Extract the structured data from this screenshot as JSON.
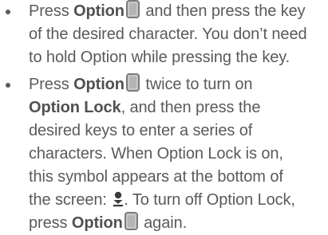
{
  "items": [
    {
      "lines": [
        {
          "before": "Press ",
          "bold": "Option",
          "after": " and then press the key",
          "key_icon": "option-key-icon"
        },
        {
          "text": "of the desired character. You don’t need"
        },
        {
          "text": "to hold Option while pressing the key."
        }
      ]
    },
    {
      "lines": [
        {
          "before": "Press ",
          "bold": "Option",
          "after": " twice to turn on",
          "key_icon": "option-key-icon"
        },
        {
          "bold": "Option Lock",
          "after": ", and then press the"
        },
        {
          "text": "desired keys to enter a series of"
        },
        {
          "text": "characters. When Option Lock is on,"
        },
        {
          "text": "this symbol appears at the bottom of"
        },
        {
          "before": "the screen: ",
          "after": ". To turn off Option Lock,",
          "symbol_icon": "option-lock-icon"
        },
        {
          "before": "press ",
          "bold": "Option",
          "after": " again.",
          "key_icon": "option-key-icon"
        }
      ]
    }
  ]
}
